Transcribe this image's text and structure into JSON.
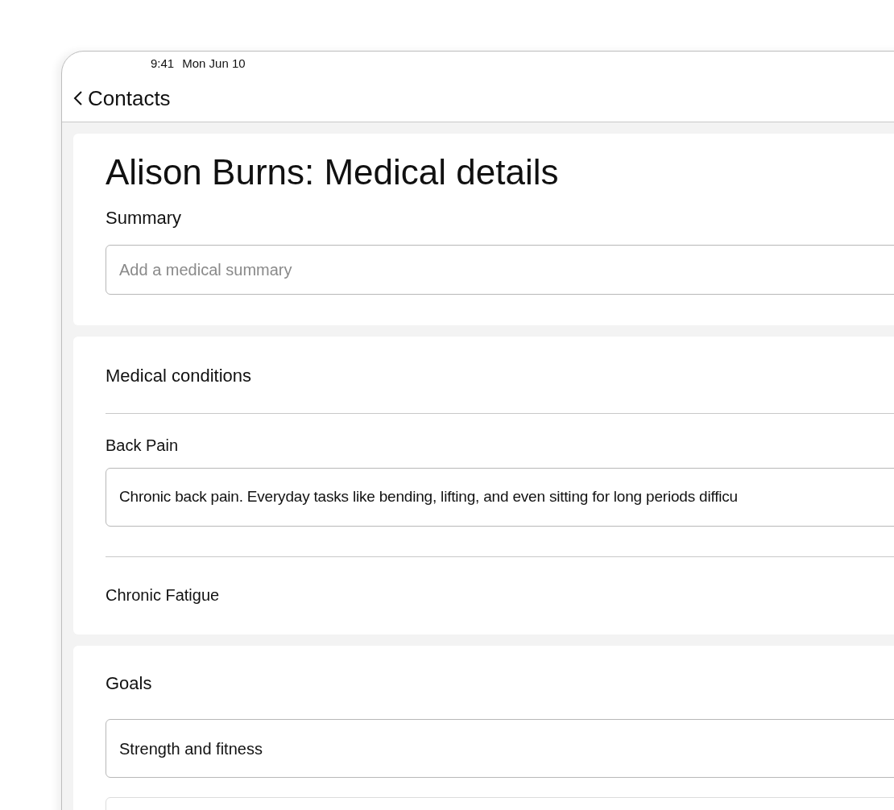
{
  "status_bar": {
    "time": "9:41",
    "date": "Mon Jun 10"
  },
  "nav": {
    "back_label": "Contacts"
  },
  "header_card": {
    "title": "Alison Burns: Medical details",
    "summary_label": "Summary",
    "summary_field": {
      "placeholder": "Add a medical summary"
    }
  },
  "conditions_card": {
    "heading": "Medical conditions",
    "conditions": [
      {
        "name": "Back Pain",
        "notes": "Chronic back pain. Everyday tasks like bending, lifting, and even sitting for long periods difficu"
      },
      {
        "name": "Chronic Fatigue"
      }
    ]
  },
  "goals_card": {
    "heading": "Goals",
    "goals": [
      {
        "value": "Strength and fitness"
      }
    ]
  }
}
